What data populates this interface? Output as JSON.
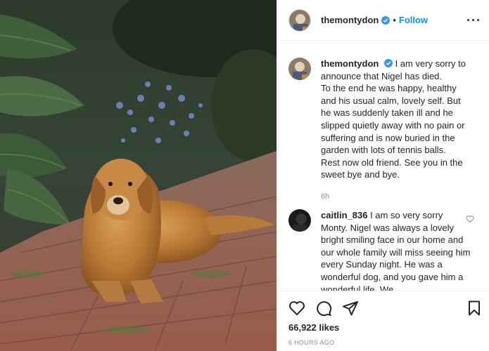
{
  "post": {
    "username": "themontydon",
    "follow_label": "Follow",
    "separator": "•",
    "more_label": "···"
  },
  "caption": {
    "username": "themontydon",
    "text": "I am very sorry to announce that Nigel has died.\nTo the end he was happy, healthy and his usual calm, lovely self. But he was suddenly taken ill and he slipped quietly away with no pain or suffering and is now buried in the garden with lots of tennis balls.\nRest now old friend. See you in the sweet bye and bye.",
    "time": "6h"
  },
  "comments": [
    {
      "username": "caitlin_836",
      "text": "I am so very sorry Monty. Nigel was always a lovely bright smiling face in our home and our whole family will miss seeing him every Sunday night. He was a wonderful dog, and you gave him a wonderful life. We"
    }
  ],
  "actions": {
    "likes": "66,922 likes",
    "posted_time": "6 HOURS AGO"
  },
  "icons": [
    "verified-badge-icon",
    "heart-icon",
    "comment-icon",
    "share-icon",
    "bookmark-icon",
    "more-options-icon"
  ],
  "colors": {
    "accent": "#0095f6",
    "text": "#262626",
    "muted": "#8e8e8e",
    "border": "#efefef"
  }
}
